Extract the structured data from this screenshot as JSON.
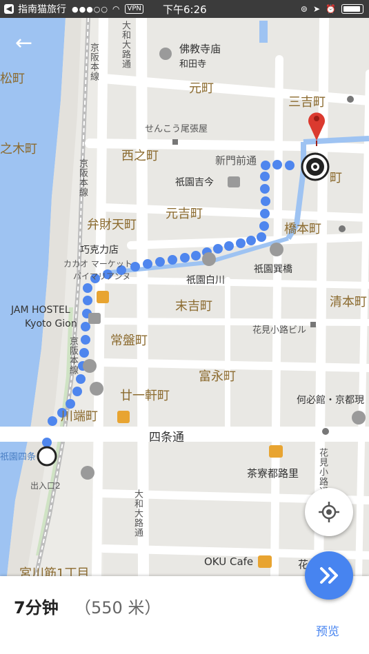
{
  "status_bar": {
    "app_name": "指南猫旅行",
    "signal": "●●●○○",
    "vpn": "VPN",
    "time": "下午6:26"
  },
  "map": {
    "area_labels": [
      {
        "text": "松町"
      },
      {
        "text": "之木町"
      },
      {
        "text": "元町"
      },
      {
        "text": "三吉町"
      },
      {
        "text": "西之町"
      },
      {
        "text": "町"
      },
      {
        "text": "元吉町"
      },
      {
        "text": "弁財天町"
      },
      {
        "text": "橋本町"
      },
      {
        "text": "末吉町"
      },
      {
        "text": "清本町"
      },
      {
        "text": "常盤町"
      },
      {
        "text": "富永町"
      },
      {
        "text": "廿一軒町"
      },
      {
        "text": "川端町"
      },
      {
        "text": "宮川筋1丁目"
      }
    ],
    "street_labels": [
      {
        "text": "四条通"
      },
      {
        "text": "大和大路通"
      },
      {
        "text": "大和大路通"
      },
      {
        "text": "新門前通"
      },
      {
        "text": "京阪本線"
      },
      {
        "text": "京阪本線"
      },
      {
        "text": "京阪本線"
      },
      {
        "text": "花見小路通"
      }
    ],
    "poi_labels": [
      {
        "text": "佛教寺庙"
      },
      {
        "text": "和田寺"
      },
      {
        "text": "せんこう尾張屋"
      },
      {
        "text": "祇園吉今"
      },
      {
        "text": "巧克力店"
      },
      {
        "text": "カカオ マーケット"
      },
      {
        "text": "バイマリアンヌ"
      },
      {
        "text": "祇園白川"
      },
      {
        "text": "祇園巽橋"
      },
      {
        "text": "JAM HOSTEL"
      },
      {
        "text": "Kyoto Gion"
      },
      {
        "text": "花見小路ビル"
      },
      {
        "text": "何必館・京都現"
      },
      {
        "text": "茶寮都路里"
      },
      {
        "text": "祇園四条"
      },
      {
        "text": "出入口2"
      },
      {
        "text": "OKU Cafe"
      },
      {
        "text": "花"
      }
    ]
  },
  "route": {
    "color": "#4f86ee",
    "origin": "祇園四条",
    "destination_marker": "red-pin"
  },
  "bottom_panel": {
    "duration": "7分钟",
    "distance": "（550 米）",
    "preview_label": "预览"
  },
  "colors": {
    "river": "#9ec3f2",
    "accent": "#4784f0",
    "map_bg": "#ecebe7",
    "road": "#ffffff",
    "label_brown": "#8b6a2e"
  }
}
